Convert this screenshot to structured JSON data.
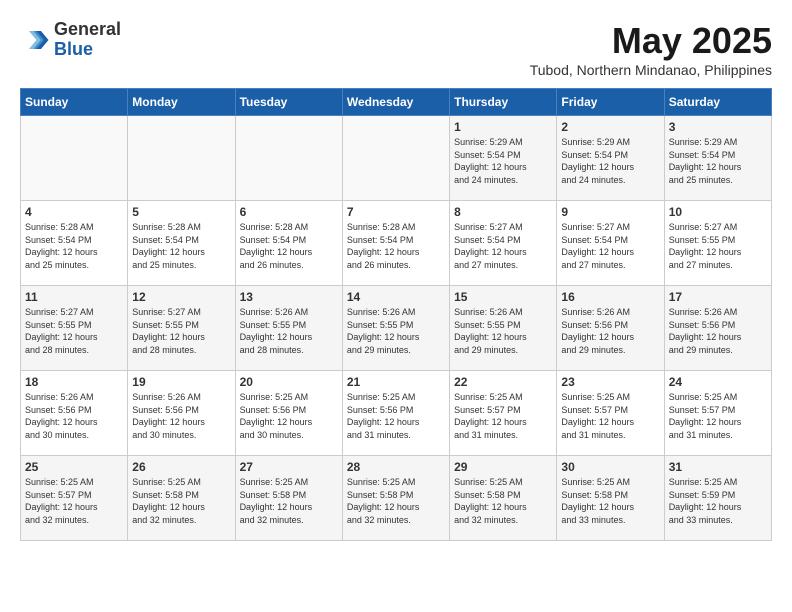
{
  "header": {
    "logo": {
      "line1": "General",
      "line2": "Blue"
    },
    "month": "May 2025",
    "location": "Tubod, Northern Mindanao, Philippines"
  },
  "weekdays": [
    "Sunday",
    "Monday",
    "Tuesday",
    "Wednesday",
    "Thursday",
    "Friday",
    "Saturday"
  ],
  "weeks": [
    [
      {
        "day": "",
        "info": ""
      },
      {
        "day": "",
        "info": ""
      },
      {
        "day": "",
        "info": ""
      },
      {
        "day": "",
        "info": ""
      },
      {
        "day": "1",
        "info": "Sunrise: 5:29 AM\nSunset: 5:54 PM\nDaylight: 12 hours\nand 24 minutes."
      },
      {
        "day": "2",
        "info": "Sunrise: 5:29 AM\nSunset: 5:54 PM\nDaylight: 12 hours\nand 24 minutes."
      },
      {
        "day": "3",
        "info": "Sunrise: 5:29 AM\nSunset: 5:54 PM\nDaylight: 12 hours\nand 25 minutes."
      }
    ],
    [
      {
        "day": "4",
        "info": "Sunrise: 5:28 AM\nSunset: 5:54 PM\nDaylight: 12 hours\nand 25 minutes."
      },
      {
        "day": "5",
        "info": "Sunrise: 5:28 AM\nSunset: 5:54 PM\nDaylight: 12 hours\nand 25 minutes."
      },
      {
        "day": "6",
        "info": "Sunrise: 5:28 AM\nSunset: 5:54 PM\nDaylight: 12 hours\nand 26 minutes."
      },
      {
        "day": "7",
        "info": "Sunrise: 5:28 AM\nSunset: 5:54 PM\nDaylight: 12 hours\nand 26 minutes."
      },
      {
        "day": "8",
        "info": "Sunrise: 5:27 AM\nSunset: 5:54 PM\nDaylight: 12 hours\nand 27 minutes."
      },
      {
        "day": "9",
        "info": "Sunrise: 5:27 AM\nSunset: 5:54 PM\nDaylight: 12 hours\nand 27 minutes."
      },
      {
        "day": "10",
        "info": "Sunrise: 5:27 AM\nSunset: 5:55 PM\nDaylight: 12 hours\nand 27 minutes."
      }
    ],
    [
      {
        "day": "11",
        "info": "Sunrise: 5:27 AM\nSunset: 5:55 PM\nDaylight: 12 hours\nand 28 minutes."
      },
      {
        "day": "12",
        "info": "Sunrise: 5:27 AM\nSunset: 5:55 PM\nDaylight: 12 hours\nand 28 minutes."
      },
      {
        "day": "13",
        "info": "Sunrise: 5:26 AM\nSunset: 5:55 PM\nDaylight: 12 hours\nand 28 minutes."
      },
      {
        "day": "14",
        "info": "Sunrise: 5:26 AM\nSunset: 5:55 PM\nDaylight: 12 hours\nand 29 minutes."
      },
      {
        "day": "15",
        "info": "Sunrise: 5:26 AM\nSunset: 5:55 PM\nDaylight: 12 hours\nand 29 minutes."
      },
      {
        "day": "16",
        "info": "Sunrise: 5:26 AM\nSunset: 5:56 PM\nDaylight: 12 hours\nand 29 minutes."
      },
      {
        "day": "17",
        "info": "Sunrise: 5:26 AM\nSunset: 5:56 PM\nDaylight: 12 hours\nand 29 minutes."
      }
    ],
    [
      {
        "day": "18",
        "info": "Sunrise: 5:26 AM\nSunset: 5:56 PM\nDaylight: 12 hours\nand 30 minutes."
      },
      {
        "day": "19",
        "info": "Sunrise: 5:26 AM\nSunset: 5:56 PM\nDaylight: 12 hours\nand 30 minutes."
      },
      {
        "day": "20",
        "info": "Sunrise: 5:25 AM\nSunset: 5:56 PM\nDaylight: 12 hours\nand 30 minutes."
      },
      {
        "day": "21",
        "info": "Sunrise: 5:25 AM\nSunset: 5:56 PM\nDaylight: 12 hours\nand 31 minutes."
      },
      {
        "day": "22",
        "info": "Sunrise: 5:25 AM\nSunset: 5:57 PM\nDaylight: 12 hours\nand 31 minutes."
      },
      {
        "day": "23",
        "info": "Sunrise: 5:25 AM\nSunset: 5:57 PM\nDaylight: 12 hours\nand 31 minutes."
      },
      {
        "day": "24",
        "info": "Sunrise: 5:25 AM\nSunset: 5:57 PM\nDaylight: 12 hours\nand 31 minutes."
      }
    ],
    [
      {
        "day": "25",
        "info": "Sunrise: 5:25 AM\nSunset: 5:57 PM\nDaylight: 12 hours\nand 32 minutes."
      },
      {
        "day": "26",
        "info": "Sunrise: 5:25 AM\nSunset: 5:58 PM\nDaylight: 12 hours\nand 32 minutes."
      },
      {
        "day": "27",
        "info": "Sunrise: 5:25 AM\nSunset: 5:58 PM\nDaylight: 12 hours\nand 32 minutes."
      },
      {
        "day": "28",
        "info": "Sunrise: 5:25 AM\nSunset: 5:58 PM\nDaylight: 12 hours\nand 32 minutes."
      },
      {
        "day": "29",
        "info": "Sunrise: 5:25 AM\nSunset: 5:58 PM\nDaylight: 12 hours\nand 32 minutes."
      },
      {
        "day": "30",
        "info": "Sunrise: 5:25 AM\nSunset: 5:58 PM\nDaylight: 12 hours\nand 33 minutes."
      },
      {
        "day": "31",
        "info": "Sunrise: 5:25 AM\nSunset: 5:59 PM\nDaylight: 12 hours\nand 33 minutes."
      }
    ]
  ]
}
